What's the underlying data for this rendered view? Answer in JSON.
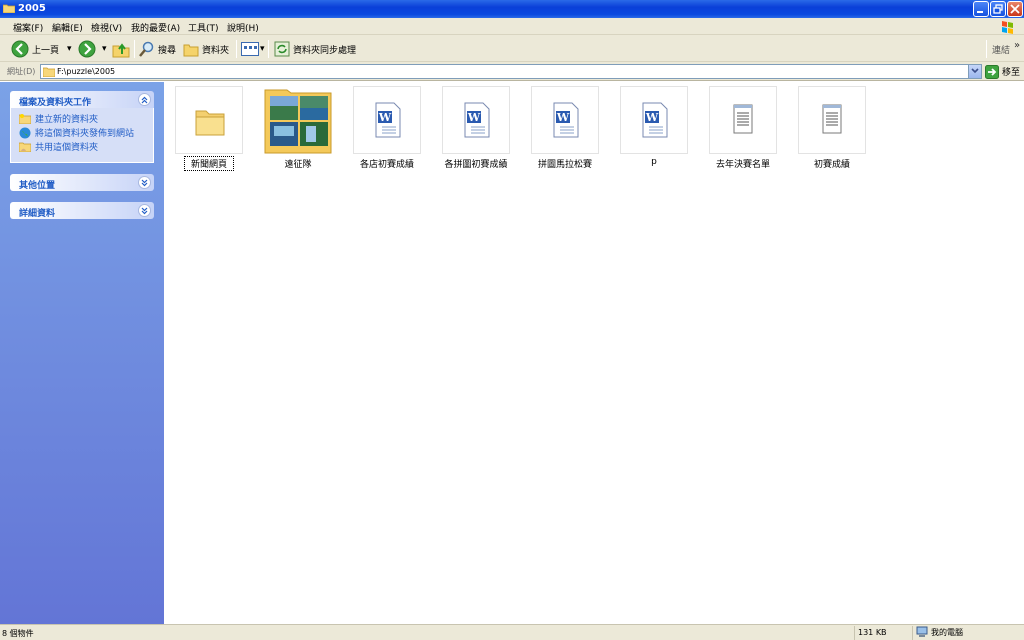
{
  "window": {
    "title": "2005"
  },
  "menu": [
    "檔案(F)",
    "編輯(E)",
    "檢視(V)",
    "我的最愛(A)",
    "工具(T)",
    "說明(H)"
  ],
  "toolbar": {
    "back_label": "上一頁",
    "search_label": "搜尋",
    "folders_label": "資料夾",
    "sync_label": "資料夾同步處理",
    "links_label": "連結"
  },
  "address": {
    "label": "網址(D)",
    "path": "F:\\puzzle\\2005",
    "go_label": "移至"
  },
  "taskpane": {
    "panel1_title": "檔案及資料夾工作",
    "tasks": [
      "建立新的資料夾",
      "將這個資料夾發佈到網站",
      "共用這個資料夾"
    ],
    "panel2_title": "其他位置",
    "panel3_title": "詳細資料"
  },
  "files": [
    {
      "name": "新聞網頁",
      "type": "folder"
    },
    {
      "name": "遠征隊",
      "type": "photo-folder"
    },
    {
      "name": "各店初賽成績",
      "type": "word"
    },
    {
      "name": "各拼圖初賽成績",
      "type": "word"
    },
    {
      "name": "拼圖馬拉松賽",
      "type": "word"
    },
    {
      "name": "p",
      "type": "word"
    },
    {
      "name": "去年決賽名單",
      "type": "notepad"
    },
    {
      "name": "初賽成績",
      "type": "notepad"
    }
  ],
  "status": {
    "items": "8 個物件",
    "size": "131 KB",
    "location": "我的電腦"
  },
  "colors": {
    "title_blue": "#0a3fd8",
    "task_blue": "#215dc6",
    "pane_grad_top": "#7ba2e7"
  }
}
